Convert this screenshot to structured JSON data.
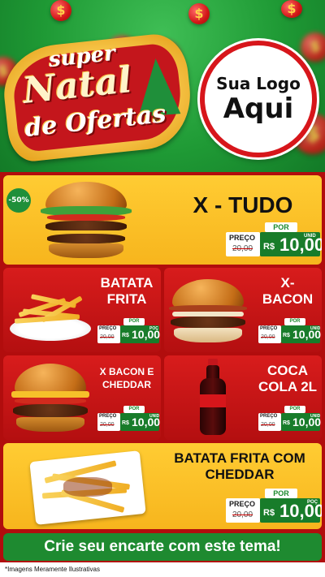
{
  "header": {
    "logo_line1": "super",
    "logo_line2": "Natal",
    "logo_line3": "de Ofertas",
    "brand_line1": "Sua Logo",
    "brand_line2": "Aqui",
    "coin_symbol": "$"
  },
  "discount_badge": "-50%",
  "products": [
    {
      "name": "X - TUDO",
      "por": "POR",
      "preco_label": "PREÇO",
      "old_price": "20,00",
      "currency": "R$",
      "price": "10,00",
      "unit": "UNID"
    },
    {
      "name_l1": "BATATA",
      "name_l2": "FRITA",
      "por": "POR",
      "preco_label": "PREÇO",
      "old_price": "20,00",
      "currency": "R$",
      "price": "10,00",
      "unit": "POÇ"
    },
    {
      "name_l1": "X-",
      "name_l2": "BACON",
      "por": "POR",
      "preco_label": "PREÇO",
      "old_price": "20,00",
      "currency": "R$",
      "price": "10,00",
      "unit": "UNID"
    },
    {
      "name_l1": "X BACON E",
      "name_l2": "CHEDDAR",
      "por": "POR",
      "preco_label": "PREÇO",
      "old_price": "20,00",
      "currency": "R$",
      "price": "10,00",
      "unit": "UNID"
    },
    {
      "name_l1": "COCA",
      "name_l2": "COLA 2L",
      "por": "POR",
      "preco_label": "PREÇO",
      "old_price": "20,00",
      "currency": "R$",
      "price": "10,00",
      "unit": "UNID"
    },
    {
      "name_l1": "BATATA FRITA COM",
      "name_l2": "CHEDDAR",
      "por": "POR",
      "preco_label": "PREÇO",
      "old_price": "20,00",
      "currency": "R$",
      "price": "10,00",
      "unit": "POÇ"
    }
  ],
  "cta": "Crie seu encarte com este tema!",
  "footer_note": "*Imagens Meramente Ilustrativas",
  "colors": {
    "red": "#c4161c",
    "green": "#1e8a30",
    "yellow": "#ffcc33"
  }
}
